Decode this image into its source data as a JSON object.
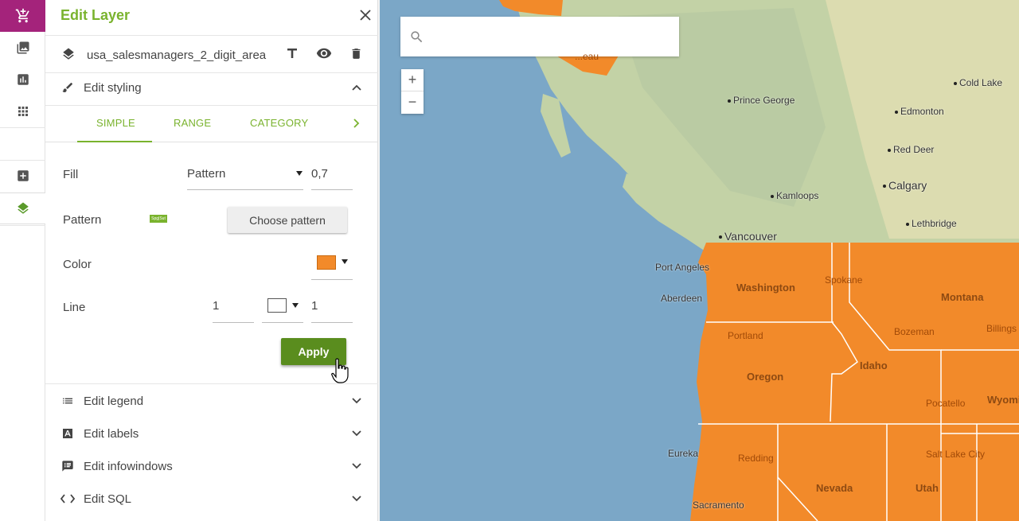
{
  "panel": {
    "title": "Edit Layer",
    "layer_name": "usa_salesmanagers_2_digit_area",
    "sections": {
      "styling": "Edit styling",
      "legend": "Edit legend",
      "labels": "Edit labels",
      "infowindows": "Edit infowindows",
      "sql": "Edit SQL"
    },
    "tabs": [
      "SIMPLE",
      "RANGE",
      "CATEGORY"
    ],
    "fill": {
      "label": "Fill",
      "type": "Pattern",
      "opacity": "0,7"
    },
    "pattern": {
      "label": "Pattern",
      "thumb_text": "Spg|Sut",
      "button": "Choose pattern"
    },
    "color": {
      "label": "Color",
      "value": "#f28a2a"
    },
    "line": {
      "label": "Line",
      "width": "1",
      "color": "#ffffff",
      "opacity": "1"
    },
    "apply_label": "Apply"
  },
  "map": {
    "search_placeholder": "",
    "zoom_in": "+",
    "zoom_out": "−",
    "cities": {
      "prince_george": "Prince George",
      "edmonton": "Edmonton",
      "cold_lake": "Cold Lake",
      "red_deer": "Red Deer",
      "calgary": "Calgary",
      "kamloops": "Kamloops",
      "lethbridge": "Lethbridge",
      "vancouver": "Vancouver",
      "port_angeles": "Port Angeles",
      "aberdeen": "Aberdeen",
      "spokane": "Spokane",
      "bozeman": "Bozeman",
      "billings": "Billings",
      "portland": "Portland",
      "pocatello": "Pocatello",
      "eureka": "Eureka",
      "redding": "Redding",
      "salt_lake_city": "Salt Lake City",
      "sacramento": "Sacramento",
      "juneau_partial": "...eau"
    },
    "states": {
      "washington": "Washington",
      "montana": "Montana",
      "oregon": "Oregon",
      "idaho": "Idaho",
      "wyoming": "Wyomi",
      "nevada": "Nevada",
      "utah": "Utah"
    },
    "colors": {
      "ocean": "#7ba7c7",
      "land": "#c9d6a8",
      "region_fill": "#f28a2a",
      "accent": "#7ab32e",
      "cart": "#a4237b"
    }
  }
}
